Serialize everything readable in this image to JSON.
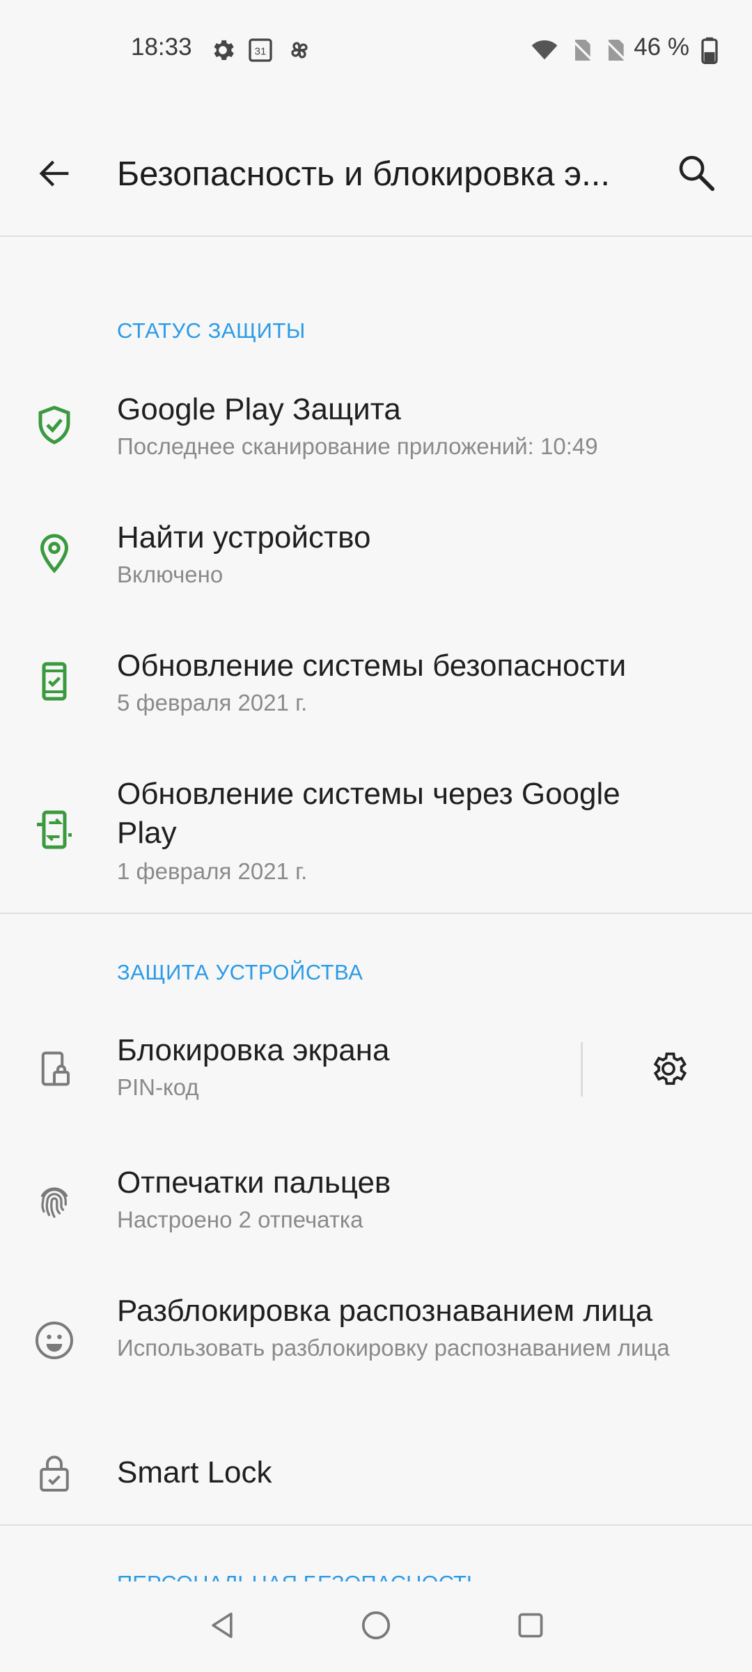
{
  "status_bar": {
    "time": "18:33",
    "battery_percent": "46 %",
    "battery_level": 0.46
  },
  "header": {
    "title": "Безопасность и блокировка э..."
  },
  "sections": {
    "protection_status": {
      "header": "СТАТУС ЗАЩИТЫ",
      "items": [
        {
          "title": "Google Play Защита",
          "subtitle": "Последнее сканирование приложений: 10:49",
          "icon": "shield-check-icon"
        },
        {
          "title": "Найти устройство",
          "subtitle": "Включено",
          "icon": "location-pin-icon"
        },
        {
          "title": "Обновление системы безопасности",
          "subtitle": "5 февраля 2021 г.",
          "icon": "phone-check-icon"
        },
        {
          "title": "Обновление системы через Google Play",
          "subtitle": "1 февраля 2021 г.",
          "icon": "phone-update-icon"
        }
      ]
    },
    "device_protection": {
      "header": "ЗАЩИТА УСТРОЙСТВА",
      "items": [
        {
          "title": "Блокировка экрана",
          "subtitle": "PIN-код",
          "icon": "phone-lock-icon"
        },
        {
          "title": "Отпечатки пальцев",
          "subtitle": "Настроено 2 отпечатка",
          "icon": "fingerprint-icon"
        },
        {
          "title": "Разблокировка распознаванием лица",
          "subtitle": "Использовать разблокировку распознаванием лица",
          "icon": "face-icon"
        },
        {
          "title": "Smart Lock",
          "icon": "lock-check-icon"
        }
      ]
    },
    "personal_security": {
      "header": "ПЕРСОНАЛЬНАЯ БЕЗОПАСНОСТЬ"
    }
  },
  "colors": {
    "accent": "#2b9be6",
    "green_icon": "#3a9a3e",
    "gray_icon": "#7a7a7a",
    "background": "#f7f7f7"
  }
}
